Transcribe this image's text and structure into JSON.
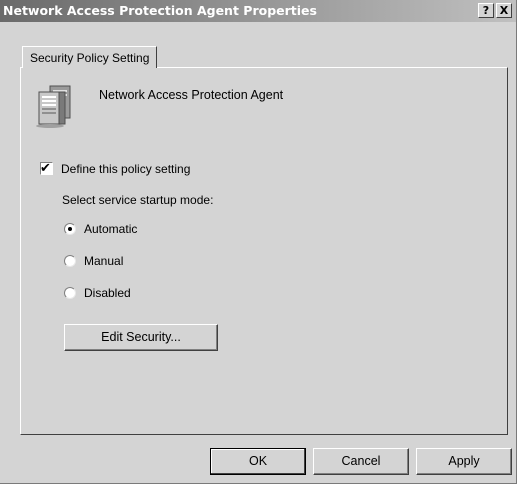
{
  "window": {
    "title": "Network Access Protection Agent Properties",
    "help_label": "?",
    "close_label": "X"
  },
  "tabs": [
    {
      "label": "Security Policy Setting",
      "selected": true
    }
  ],
  "main": {
    "agent_name": "Network Access Protection Agent",
    "icon": "server-icon",
    "define_policy": {
      "label": "Define this policy setting",
      "checked": true
    },
    "startup_mode_label": "Select service startup mode:",
    "startup_options": [
      {
        "label": "Automatic",
        "selected": true
      },
      {
        "label": "Manual",
        "selected": false
      },
      {
        "label": "Disabled",
        "selected": false
      }
    ],
    "edit_security_label": "Edit Security..."
  },
  "footer": {
    "ok_label": "OK",
    "cancel_label": "Cancel",
    "apply_label": "Apply"
  },
  "colors": {
    "dialog_background": "#d4d4d4",
    "titlebar_start": "#6a6a6a",
    "titlebar_end": "#c0c0c0"
  }
}
